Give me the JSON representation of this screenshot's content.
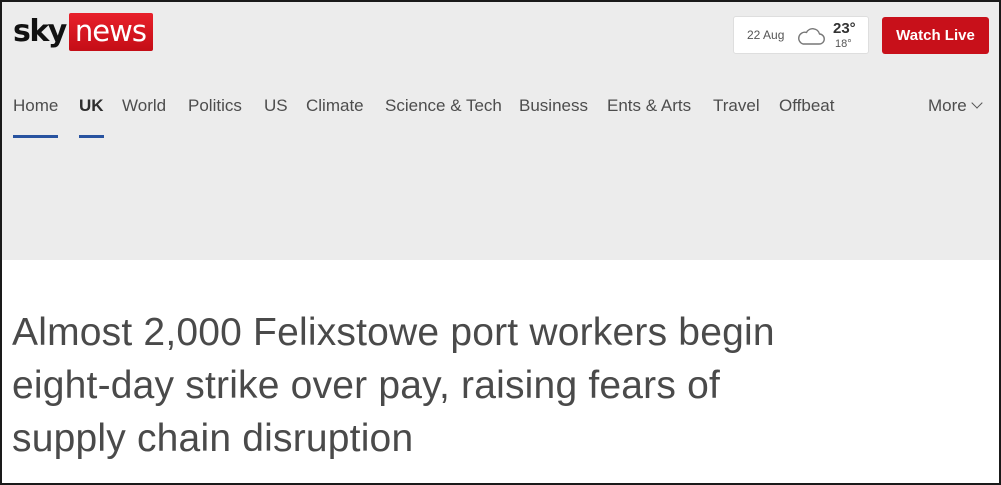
{
  "brand": {
    "logo_sky": "sky",
    "logo_news": "news",
    "accent": "#c8101a",
    "nav_highlight": "#2853a0"
  },
  "weather": {
    "date": "22 Aug",
    "icon": "cloud-icon",
    "high": "23°",
    "low": "18°"
  },
  "header": {
    "watch_live": "Watch Live"
  },
  "nav": {
    "items": [
      {
        "label": "Home"
      },
      {
        "label": "UK"
      },
      {
        "label": "World"
      },
      {
        "label": "Politics"
      },
      {
        "label": "US"
      },
      {
        "label": "Climate"
      },
      {
        "label": "Science & Tech"
      },
      {
        "label": "Business"
      },
      {
        "label": "Ents & Arts"
      },
      {
        "label": "Travel"
      },
      {
        "label": "Offbeat"
      }
    ],
    "more": "More",
    "active": "UK"
  },
  "article": {
    "headline": "Almost 2,000 Felixstowe port workers begin eight-day strike over pay, raising fears of supply chain disruption"
  }
}
